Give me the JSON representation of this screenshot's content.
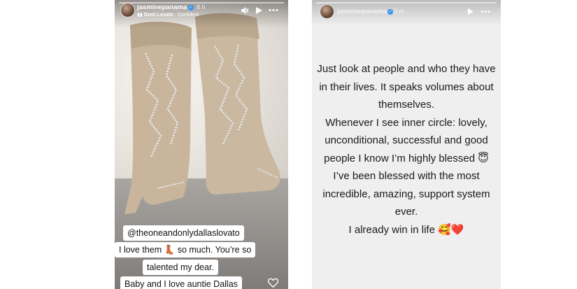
{
  "left_story": {
    "username": "jasminepanama",
    "time": "8 h",
    "music": {
      "artist": "Demi Lovato",
      "separator": "·",
      "song": "Confident"
    },
    "caption": {
      "mention": "@theoneandonlydallaslovato",
      "line1_a": "I love them",
      "line1_emoji": "👢",
      "line1_b": "so much. You’re so",
      "line2": "talented my dear.",
      "line3": "Baby and I love auntie Dallas"
    },
    "icons": {
      "mute": "mute-icon",
      "play": "play-icon",
      "more": "more-icon",
      "like": "heart-icon"
    }
  },
  "right_story": {
    "username": "jasminepanama",
    "time": "3 m",
    "lines": [
      "Just look at people and who they have",
      "in their lives. It speaks volumes about",
      "themselves.",
      "Whenever I see inner circle: lovely,",
      "unconditional, successful and good",
      "people I know I’m highly blessed 😇",
      "I’ve been blessed with the most",
      "incredible, amazing, support system",
      "ever.",
      "I already win in life 🥰❤️"
    ],
    "icons": {
      "play": "play-icon",
      "more": "more-icon"
    }
  },
  "colors": {
    "verified_blue": "#3897f0",
    "right_bg": "#efefef",
    "boot_tan": "#c9b59b"
  }
}
